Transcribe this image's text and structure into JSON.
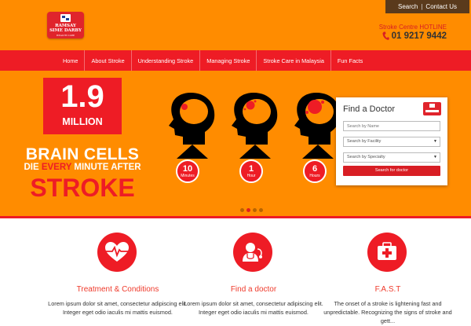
{
  "header": {
    "logo": {
      "line1": "RAMSAY",
      "line2": "SIME DARBY",
      "line3": "HEALTH CARE"
    },
    "top_links": [
      "Search",
      "Contact Us"
    ],
    "hotline_label": "Stroke Centre HOTLINE",
    "hotline_number": "01 9217 9442"
  },
  "nav": {
    "items": [
      "Home",
      "About Stroke",
      "Understanding Stroke",
      "Managing Stroke",
      "Stroke Care in Malaysia",
      "Fun Facts"
    ]
  },
  "hero": {
    "stat_value": "1.9",
    "stat_unit": "MILLION",
    "headline_line1": "BRAIN CELLS",
    "headline_die": "DIE",
    "headline_every": "EVERY",
    "headline_rest": "MINUTE AFTER",
    "headline_line3": "STROKE",
    "timeline": [
      {
        "value": "10",
        "unit": "Minutes"
      },
      {
        "value": "1",
        "unit": "Hour"
      },
      {
        "value": "6",
        "unit": "Hours"
      }
    ],
    "slides": {
      "count": 4,
      "active_index": 1
    }
  },
  "finder": {
    "title": "Find a Doctor",
    "name_placeholder": "Search by Name",
    "facility_placeholder": "Search by Facility",
    "specialty_placeholder": "Search by Specialty",
    "button_label": "Search for doctor"
  },
  "features": [
    {
      "icon": "heart-pulse-icon",
      "title": "Treatment & Conditions",
      "text": "Lorem ipsum dolor sit amet, consectetur adipiscing elit. Integer eget odio iaculis mi mattis euismod."
    },
    {
      "icon": "doctor-stethoscope-icon",
      "title": "Find a doctor",
      "text": "Lorem ipsum dolor sit amet, consectetur adipiscing elit. Integer eget odio iaculis mi mattis euismod."
    },
    {
      "icon": "first-aid-kit-icon",
      "title": "F.A.S.T",
      "text": "The onset of a stroke is lightening fast and unpredictable. Recognizing the signs of stroke and gett..."
    }
  ],
  "colors": {
    "orange": "#ff8c00",
    "red": "#ee1c25",
    "dark_brown": "#5a3a1c"
  }
}
